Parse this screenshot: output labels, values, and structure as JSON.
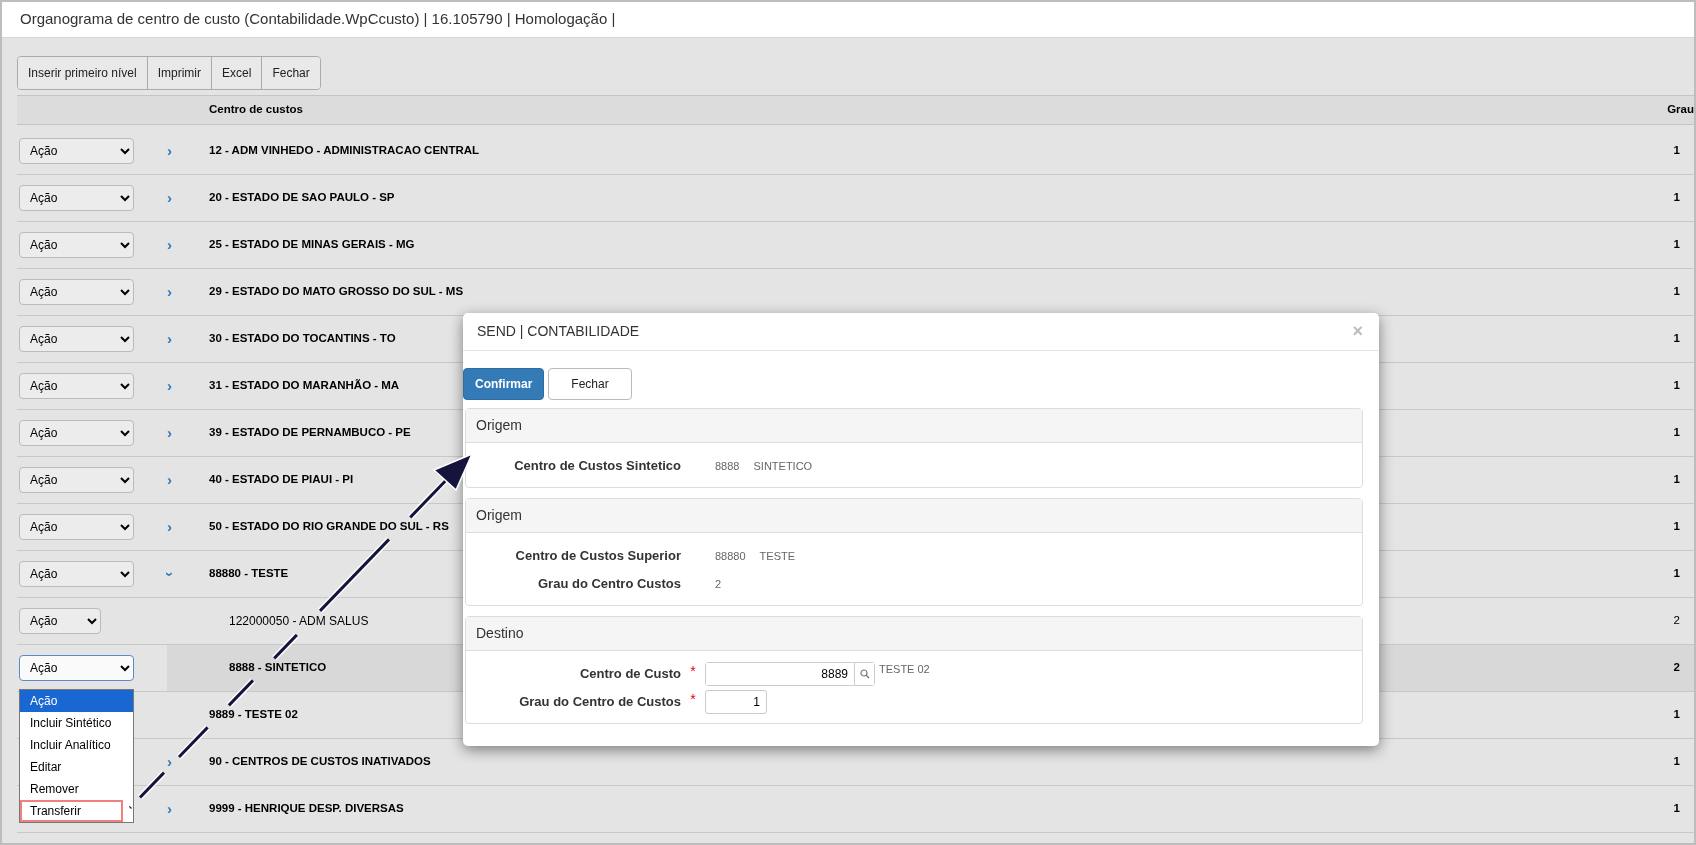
{
  "window": {
    "title": "Organograma de centro de custo (Contabilidade.WpCcusto) | 16.105790 | Homologação |"
  },
  "toolbar": [
    "Inserir primeiro nível",
    "Imprimir",
    "Excel",
    "Fechar"
  ],
  "table": {
    "columns": [
      "Centro de custos",
      "Grau"
    ],
    "rows": [
      {
        "action": "Ação",
        "expander": "›",
        "expanded": false,
        "name": "12 - ADM VINHEDO - ADMINISTRACAO CENTRAL",
        "grau": "1",
        "selected": false
      },
      {
        "action": "Ação",
        "expander": "›",
        "expanded": false,
        "name": "20 - ESTADO DE SAO PAULO - SP",
        "grau": "1",
        "selected": false
      },
      {
        "action": "Ação",
        "expander": "›",
        "expanded": false,
        "name": "25 - ESTADO DE MINAS GERAIS - MG",
        "grau": "1",
        "selected": false
      },
      {
        "action": "Ação",
        "expander": "›",
        "expanded": false,
        "name": "29 - ESTADO DO MATO GROSSO DO SUL - MS",
        "grau": "1",
        "selected": false
      },
      {
        "action": "Ação",
        "expander": "›",
        "expanded": false,
        "name": "30 - ESTADO DO TOCANTINS - TO",
        "grau": "1",
        "selected": false
      },
      {
        "action": "Ação",
        "expander": "›",
        "expanded": false,
        "name": "31 - ESTADO DO MARANHÃO - MA",
        "grau": "1",
        "selected": false
      },
      {
        "action": "Ação",
        "expander": "›",
        "expanded": false,
        "name": "39 - ESTADO DE PERNAMBUCO - PE",
        "grau": "1",
        "selected": false
      },
      {
        "action": "Ação",
        "expander": "›",
        "expanded": false,
        "name": "40 - ESTADO DE PIAUI - PI",
        "grau": "1",
        "selected": false
      },
      {
        "action": "Ação",
        "expander": "›",
        "expanded": false,
        "name": "50 - ESTADO DO RIO GRANDE DO SUL - RS",
        "grau": "1",
        "selected": false
      },
      {
        "action": "Ação",
        "expander": "›",
        "expanded": true,
        "name": "88880 - TESTE",
        "grau": "1",
        "selected": false,
        "children": [
          {
            "kind": "analytic",
            "action": "Ação",
            "name": "122000050 - ADM SALUS",
            "grau": "2",
            "selected": false
          },
          {
            "kind": "synthetic",
            "action": "Ação",
            "name": "8888 - SINTETICO",
            "grau": "2",
            "selected": true,
            "menu": [
              {
                "label": "Ação",
                "selected": true,
                "highlighted": false
              },
              {
                "label": "Incluir Sintético",
                "selected": false,
                "highlighted": false
              },
              {
                "label": "Incluir Analítico",
                "selected": false,
                "highlighted": false
              },
              {
                "label": "Editar",
                "selected": false,
                "highlighted": false
              },
              {
                "label": "Remover",
                "selected": false,
                "highlighted": false
              },
              {
                "label": "Transferir",
                "selected": false,
                "highlighted": true
              }
            ]
          }
        ]
      },
      {
        "name": "9889 - TESTE 02",
        "grau": "1",
        "selected": false
      },
      {
        "expander": "›",
        "expanded": false,
        "name": "90 - CENTROS DE CUSTOS INATIVADOS",
        "grau": "1",
        "selected": false
      },
      {
        "expander": "›",
        "expanded": false,
        "name": "9999 - HENRIQUE DESP. DIVERSAS",
        "grau": "1",
        "selected": false
      }
    ]
  },
  "dialog": {
    "title": "SEND | CONTABILIDADE",
    "close": "×",
    "buttons": [
      {
        "label": "Confirmar",
        "primary": true
      },
      {
        "label": "Fechar",
        "primary": false
      }
    ],
    "sections": [
      {
        "heading": "Origem",
        "fields": [
          {
            "kind": "display",
            "label": "Centro de Custos Sintetico",
            "code": "8888",
            "description": "SINTETICO"
          }
        ]
      },
      {
        "heading": "Origem",
        "fields": [
          {
            "kind": "display",
            "label": "Centro de Custos Superior",
            "code": "88880",
            "description": "TESTE"
          },
          {
            "kind": "display",
            "label": "Grau do Centro Custos",
            "code": "2"
          }
        ]
      },
      {
        "heading": "Destino",
        "fields": [
          {
            "kind": "lookup",
            "label": "Centro de Custo",
            "required_mark": "*",
            "value": "8889",
            "description": "TESTE 02"
          },
          {
            "kind": "input",
            "label": "Grau do Centro de Custos",
            "required_mark": "*",
            "value": "1"
          }
        ]
      }
    ]
  },
  "annotation": {
    "kind": "arrow"
  }
}
